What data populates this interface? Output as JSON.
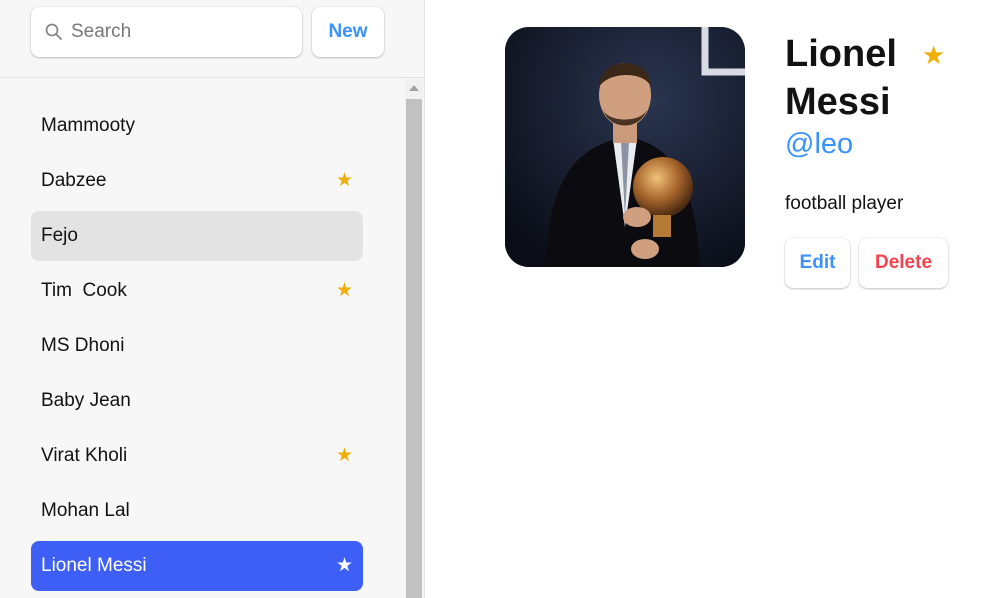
{
  "search": {
    "placeholder": "Search",
    "value": ""
  },
  "sidebar": {
    "new_label": "New",
    "contacts": [
      {
        "name": "Mammooty",
        "favorite": "",
        "state": ""
      },
      {
        "name": "Dabzee",
        "favorite": "★",
        "state": ""
      },
      {
        "name": "Fejo",
        "favorite": "",
        "state": "pending"
      },
      {
        "name": "Tim  Cook",
        "favorite": "★",
        "state": ""
      },
      {
        "name": "MS Dhoni",
        "favorite": "",
        "state": ""
      },
      {
        "name": "Baby Jean",
        "favorite": "",
        "state": ""
      },
      {
        "name": "Virat Kholi",
        "favorite": "★",
        "state": ""
      },
      {
        "name": "Mohan Lal",
        "favorite": "",
        "state": ""
      },
      {
        "name": "Lionel Messi",
        "favorite": "★",
        "state": "active"
      }
    ]
  },
  "contact": {
    "name": "Lionel Messi",
    "favorite_icon": "★",
    "handle": "@leo",
    "notes": "football player",
    "edit_label": "Edit",
    "delete_label": "Delete",
    "avatar_icon": "profile-photo"
  },
  "colors": {
    "accent": "#3992ff",
    "active": "#3d5ff6",
    "star": "#eeb004",
    "danger": "#f44250"
  }
}
